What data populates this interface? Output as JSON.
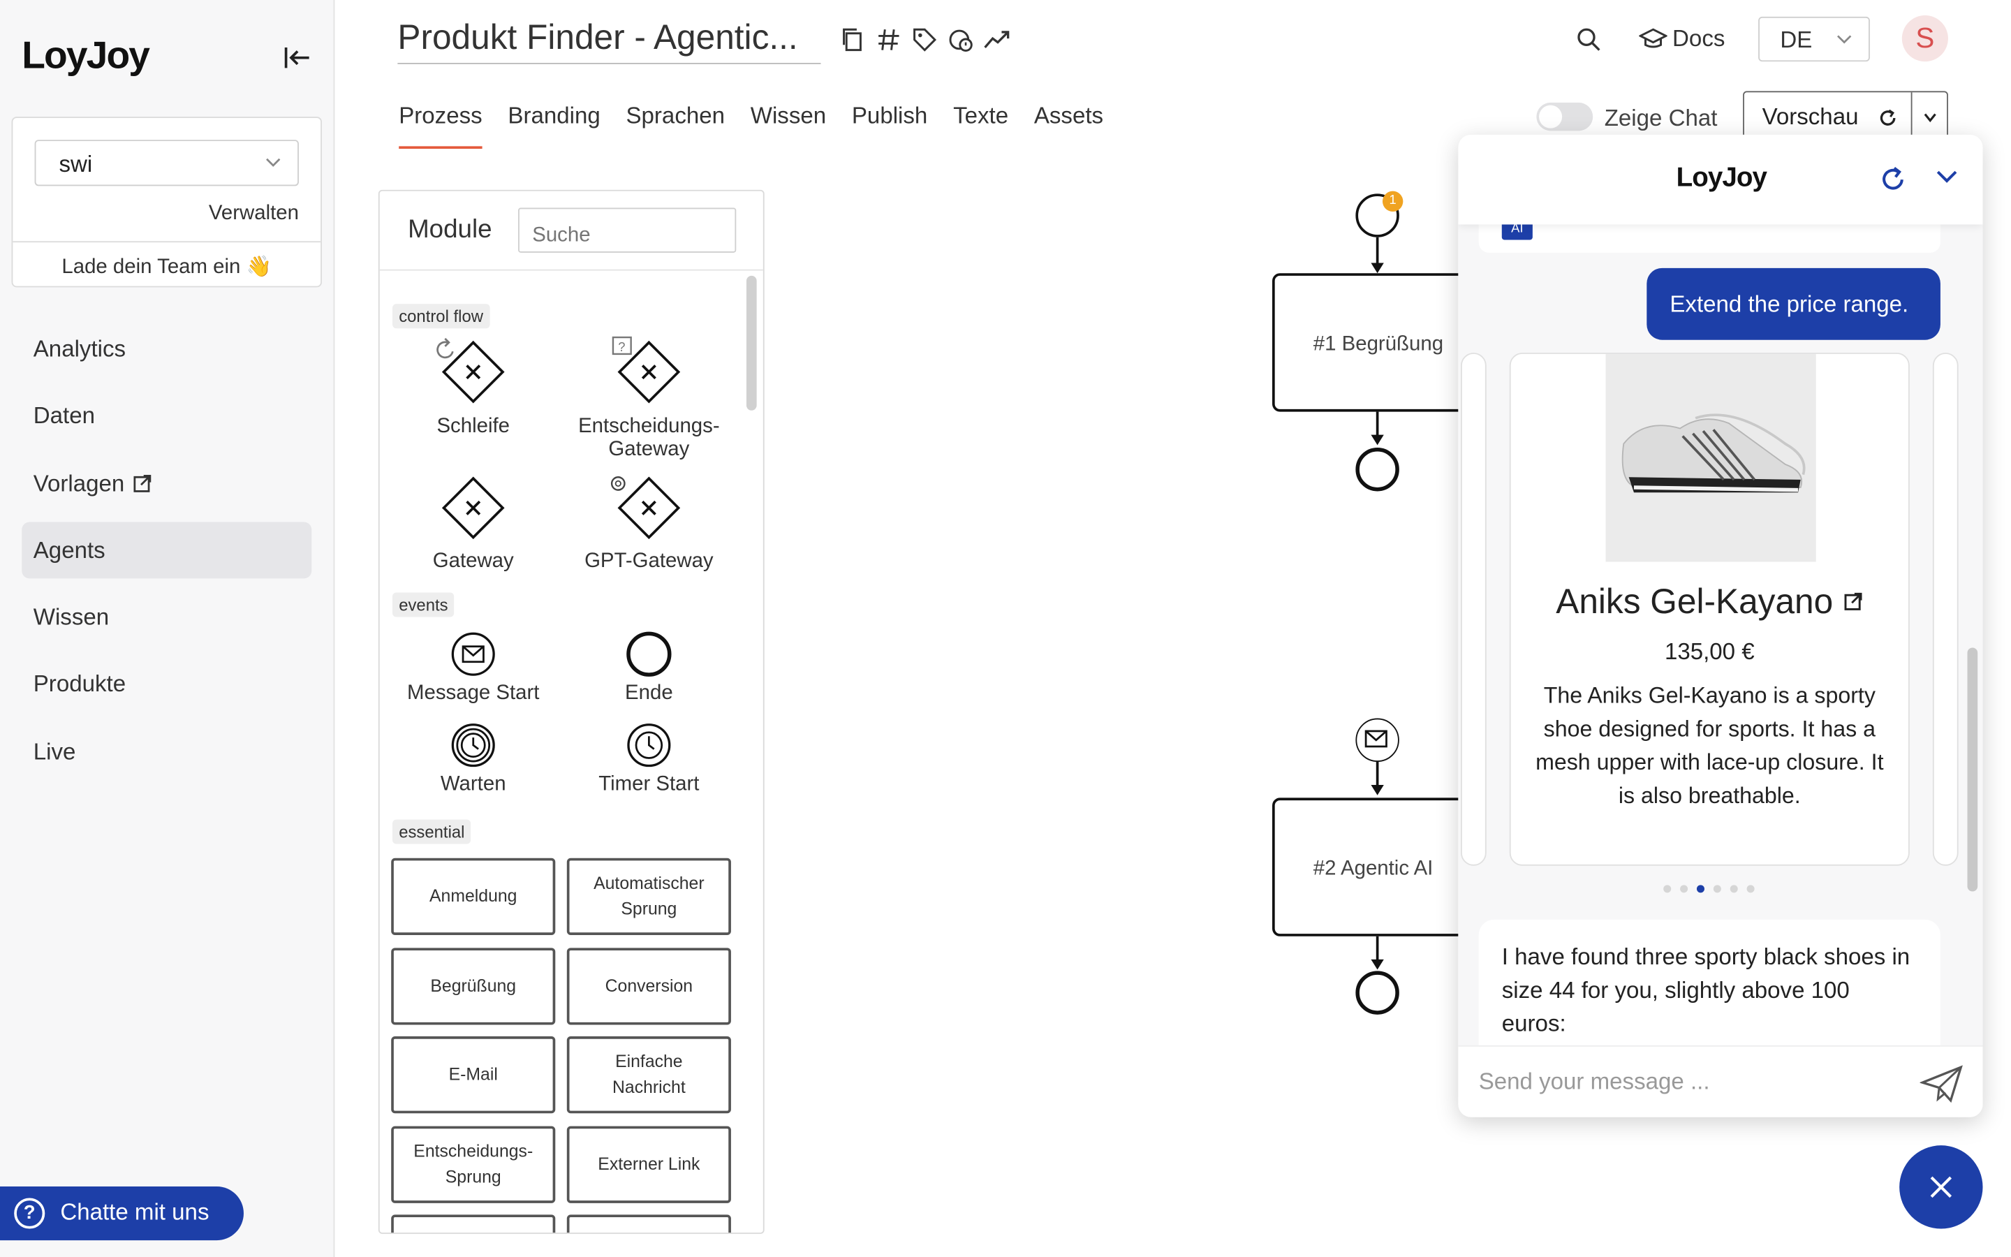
{
  "brand": {
    "logo": "LoyJoy",
    "accent": "#1d3fa8",
    "tab_underline": "#e45a3c"
  },
  "sidebar": {
    "team_select": "swi",
    "manage": "Verwalten",
    "invite": "Lade dein Team ein 👋",
    "nav": [
      {
        "label": "Analytics"
      },
      {
        "label": "Daten"
      },
      {
        "label": "Vorlagen"
      },
      {
        "label": "Agents"
      },
      {
        "label": "Wissen"
      },
      {
        "label": "Produkte"
      },
      {
        "label": "Live"
      }
    ],
    "chat_pill": "Chatte mit uns"
  },
  "header": {
    "title": "Produkt Finder - Agentic...",
    "docs": "Docs",
    "lang": "DE",
    "avatar": "S",
    "tabs": [
      "Prozess",
      "Branding",
      "Sprachen",
      "Wissen",
      "Publish",
      "Texte",
      "Assets"
    ],
    "show_chat": "Zeige Chat",
    "preview": "Vorschau"
  },
  "modules": {
    "title": "Module",
    "search_placeholder": "Suche",
    "categories": [
      "control flow",
      "events",
      "essential"
    ],
    "control_flow": [
      "Schleife",
      "Entscheidungs-Gateway",
      "Gateway",
      "GPT-Gateway"
    ],
    "events": [
      "Message Start",
      "Ende",
      "Warten",
      "Timer Start"
    ],
    "essential": [
      "Anmeldung",
      "Automatischer Sprung",
      "Begrüßung",
      "Conversion",
      "E-Mail",
      "Einfache Nachricht",
      "Entscheidungs-Sprung",
      "Externer Link"
    ]
  },
  "flow": {
    "task1": "#1 Begrüßung",
    "task2": "#2 Agentic AI",
    "badge": "1"
  },
  "chat": {
    "logo": "LoyJoy",
    "ai_tag": "AI",
    "user_message": "Extend the price range.",
    "product": {
      "name": "Aniks Gel-Kayano",
      "price": "135,00 €",
      "description": "The Aniks Gel-Kayano is a sporty shoe designed for sports. It has a mesh upper with lace-up closure. It is also breathable."
    },
    "carousel_dots": 6,
    "carousel_active": 2,
    "bot_message": "I have found three sporty black shoes in size 44 for you, slightly above 100 euros:",
    "input_placeholder": "Send your message ..."
  }
}
